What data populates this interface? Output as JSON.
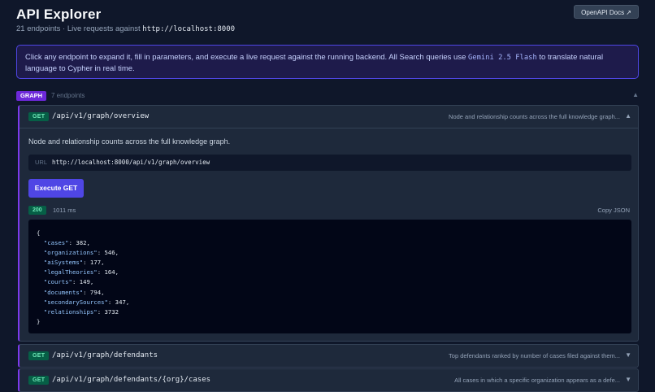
{
  "header": {
    "title": "API Explorer",
    "subtitle_prefix": "21 endpoints · Live requests against ",
    "base_url": "http://localhost:8000",
    "docs_button": "OpenAPI Docs ↗"
  },
  "info": {
    "text_before": "Click any endpoint to expand it, fill in parameters, and execute a live request against the running backend. All Search queries use ",
    "model": "Gemini 2.5 Flash",
    "text_after": " to translate natural language to Cypher in real time."
  },
  "group": {
    "badge": "GRAPH",
    "count": "7 endpoints",
    "caret": "▲"
  },
  "endpoints": [
    {
      "method": "GET",
      "path": "/api/v1/graph/overview",
      "description": "Node and relationship counts across the full knowledge graph...",
      "caret": "▲",
      "expanded": {
        "full_description": "Node and relationship counts across the full knowledge graph.",
        "url_label": "URL",
        "url": "http://localhost:8000/api/v1/graph/overview",
        "execute_label": "Execute GET",
        "status": "200",
        "timing": "1011 ms",
        "copy_label": "Copy JSON",
        "response": [
          {
            "key": "\"cases\"",
            "value": "382,"
          },
          {
            "key": "\"organizations\"",
            "value": "546,"
          },
          {
            "key": "\"aiSystems\"",
            "value": "177,"
          },
          {
            "key": "\"legalTheories\"",
            "value": "164,"
          },
          {
            "key": "\"courts\"",
            "value": "149,"
          },
          {
            "key": "\"documents\"",
            "value": "794,"
          },
          {
            "key": "\"secondarySources\"",
            "value": "347,"
          },
          {
            "key": "\"relationships\"",
            "value": "3732"
          }
        ],
        "open_brace": "{",
        "close_brace": "}"
      }
    },
    {
      "method": "GET",
      "path": "/api/v1/graph/defendants",
      "description": "Top defendants ranked by number of cases filed against them...",
      "caret": "▼"
    },
    {
      "method": "GET",
      "path": "/api/v1/graph/defendants/{org}/cases",
      "description": "All cases in which a specific organization appears as a defe...",
      "caret": "▼"
    }
  ]
}
